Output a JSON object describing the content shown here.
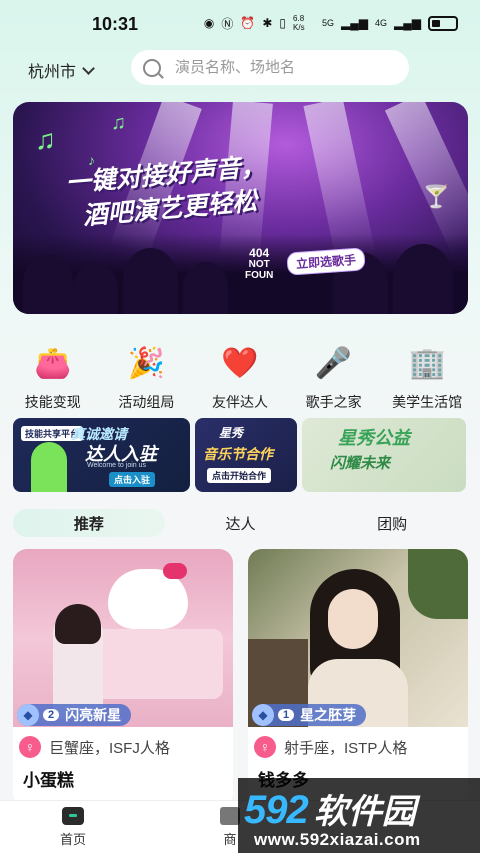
{
  "status_bar": {
    "time": "10:31",
    "net_speed": "6.8 K/s",
    "signal_5g": "5G",
    "signal_4g": "4G"
  },
  "header": {
    "city": "杭州市",
    "search_placeholder": "演员名称、场地名"
  },
  "banner": {
    "line1": "一键对接好声音，",
    "line2": "酒吧演艺更轻松",
    "cta": "立即选歌手",
    "notfound": "404",
    "notfound_sub": "NOT",
    "notfound_sub2": "FOUN"
  },
  "categories": [
    {
      "label": "技能变现",
      "icon": "wallet-icon",
      "glyph": "👛"
    },
    {
      "label": "活动组局",
      "icon": "party-popper-icon",
      "glyph": "🎉"
    },
    {
      "label": "友伴达人",
      "icon": "heart-icon",
      "glyph": "❤️"
    },
    {
      "label": "歌手之家",
      "icon": "microphone-icon",
      "glyph": "🎤"
    },
    {
      "label": "美学生活馆",
      "icon": "building-icon",
      "glyph": "🏢"
    }
  ],
  "promos": [
    {
      "tag": "技能共享平台",
      "title": "真诚邀请",
      "title2": "达人入驻",
      "sub": "点击入驻",
      "small": "Welcome to join us"
    },
    {
      "title": "星秀",
      "title2": "音乐节合作",
      "sub": "点击开始合作"
    },
    {
      "title": "星秀公益",
      "title2": "闪耀未来"
    }
  ],
  "tabs": [
    "推荐",
    "达人",
    "团购"
  ],
  "cards": [
    {
      "level": "2",
      "badge": "闪亮新星",
      "sign": "巨蟹座，ISFJ人格",
      "name": "小蛋糕"
    },
    {
      "level": "1",
      "badge": "星之胚芽",
      "sign": "射手座，ISTP人格",
      "name": "钱多多"
    }
  ],
  "bottom_nav": {
    "home": "首页",
    "shop": "商"
  },
  "watermark": {
    "brand_num": "592",
    "brand_cn": "软件园",
    "url": "www.592xiazai.com"
  },
  "colors": {
    "accent": "#2fc59a",
    "female": "#f85c8c",
    "badge": "#506ec8"
  }
}
